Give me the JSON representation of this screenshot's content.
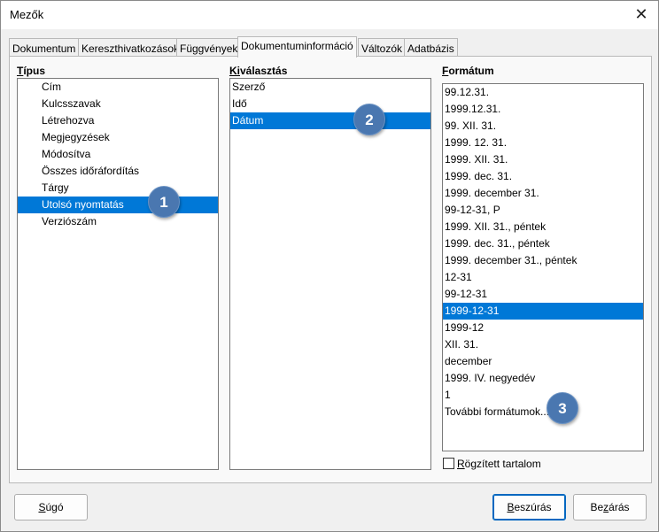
{
  "window": {
    "title": "Mezők",
    "close_glyph": "✕"
  },
  "tabs": [
    {
      "label": "Dokumentum",
      "active": false
    },
    {
      "label": "Kereszthivatkozások",
      "active": false
    },
    {
      "label": "Függvények",
      "active": false
    },
    {
      "label": "Dokumentuminformáció",
      "active": true
    },
    {
      "label": "Változók",
      "active": false
    },
    {
      "label": "Adatbázis",
      "active": false
    }
  ],
  "type_list": {
    "label_u": "T",
    "label_rest": "ípus",
    "items": [
      {
        "label": "Cím",
        "selected": false
      },
      {
        "label": "Kulcsszavak",
        "selected": false
      },
      {
        "label": "Létrehozva",
        "selected": false
      },
      {
        "label": "Megjegyzések",
        "selected": false
      },
      {
        "label": "Módosítva",
        "selected": false
      },
      {
        "label": "Összes időráfordítás",
        "selected": false
      },
      {
        "label": "Tárgy",
        "selected": false
      },
      {
        "label": "Utolsó nyomtatás",
        "selected": true
      },
      {
        "label": "Verziószám",
        "selected": false
      }
    ]
  },
  "select_list": {
    "label_u": "Ki",
    "label_rest": "választás",
    "items": [
      {
        "label": "Szerző",
        "selected": false
      },
      {
        "label": "Idő",
        "selected": false
      },
      {
        "label": "Dátum",
        "selected": true
      }
    ]
  },
  "format_list": {
    "label_u": "F",
    "label_rest": "ormátum",
    "items": [
      {
        "label": "99.12.31.",
        "selected": false
      },
      {
        "label": "1999.12.31.",
        "selected": false
      },
      {
        "label": "99. XII. 31.",
        "selected": false
      },
      {
        "label": "1999. 12. 31.",
        "selected": false
      },
      {
        "label": "1999. XII. 31.",
        "selected": false
      },
      {
        "label": "1999. dec. 31.",
        "selected": false
      },
      {
        "label": "1999. december 31.",
        "selected": false
      },
      {
        "label": "99-12-31, P",
        "selected": false
      },
      {
        "label": "1999. XII. 31., péntek",
        "selected": false
      },
      {
        "label": "1999. dec. 31., péntek",
        "selected": false
      },
      {
        "label": "1999. december 31., péntek",
        "selected": false
      },
      {
        "label": "12-31",
        "selected": false
      },
      {
        "label": "99-12-31",
        "selected": false
      },
      {
        "label": "1999-12-31",
        "selected": true
      },
      {
        "label": "1999-12",
        "selected": false
      },
      {
        "label": "XII. 31.",
        "selected": false
      },
      {
        "label": "december",
        "selected": false
      },
      {
        "label": "1999. IV. negyedév",
        "selected": false
      },
      {
        "label": "1",
        "selected": false
      },
      {
        "label": "További formátumok...",
        "selected": false
      }
    ]
  },
  "fixed_content": {
    "label_u": "R",
    "label_rest": "ögzített tartalom",
    "checked": false
  },
  "buttons": {
    "help_u": "S",
    "help_rest": "úgó",
    "insert_u": "B",
    "insert_rest": "eszúrás",
    "close_pre": "Be",
    "close_u": "z",
    "close_rest": "árás"
  },
  "callouts": [
    "1",
    "2",
    "3"
  ],
  "colors": {
    "selection": "#0078d7",
    "callout": "#4a77b0"
  }
}
